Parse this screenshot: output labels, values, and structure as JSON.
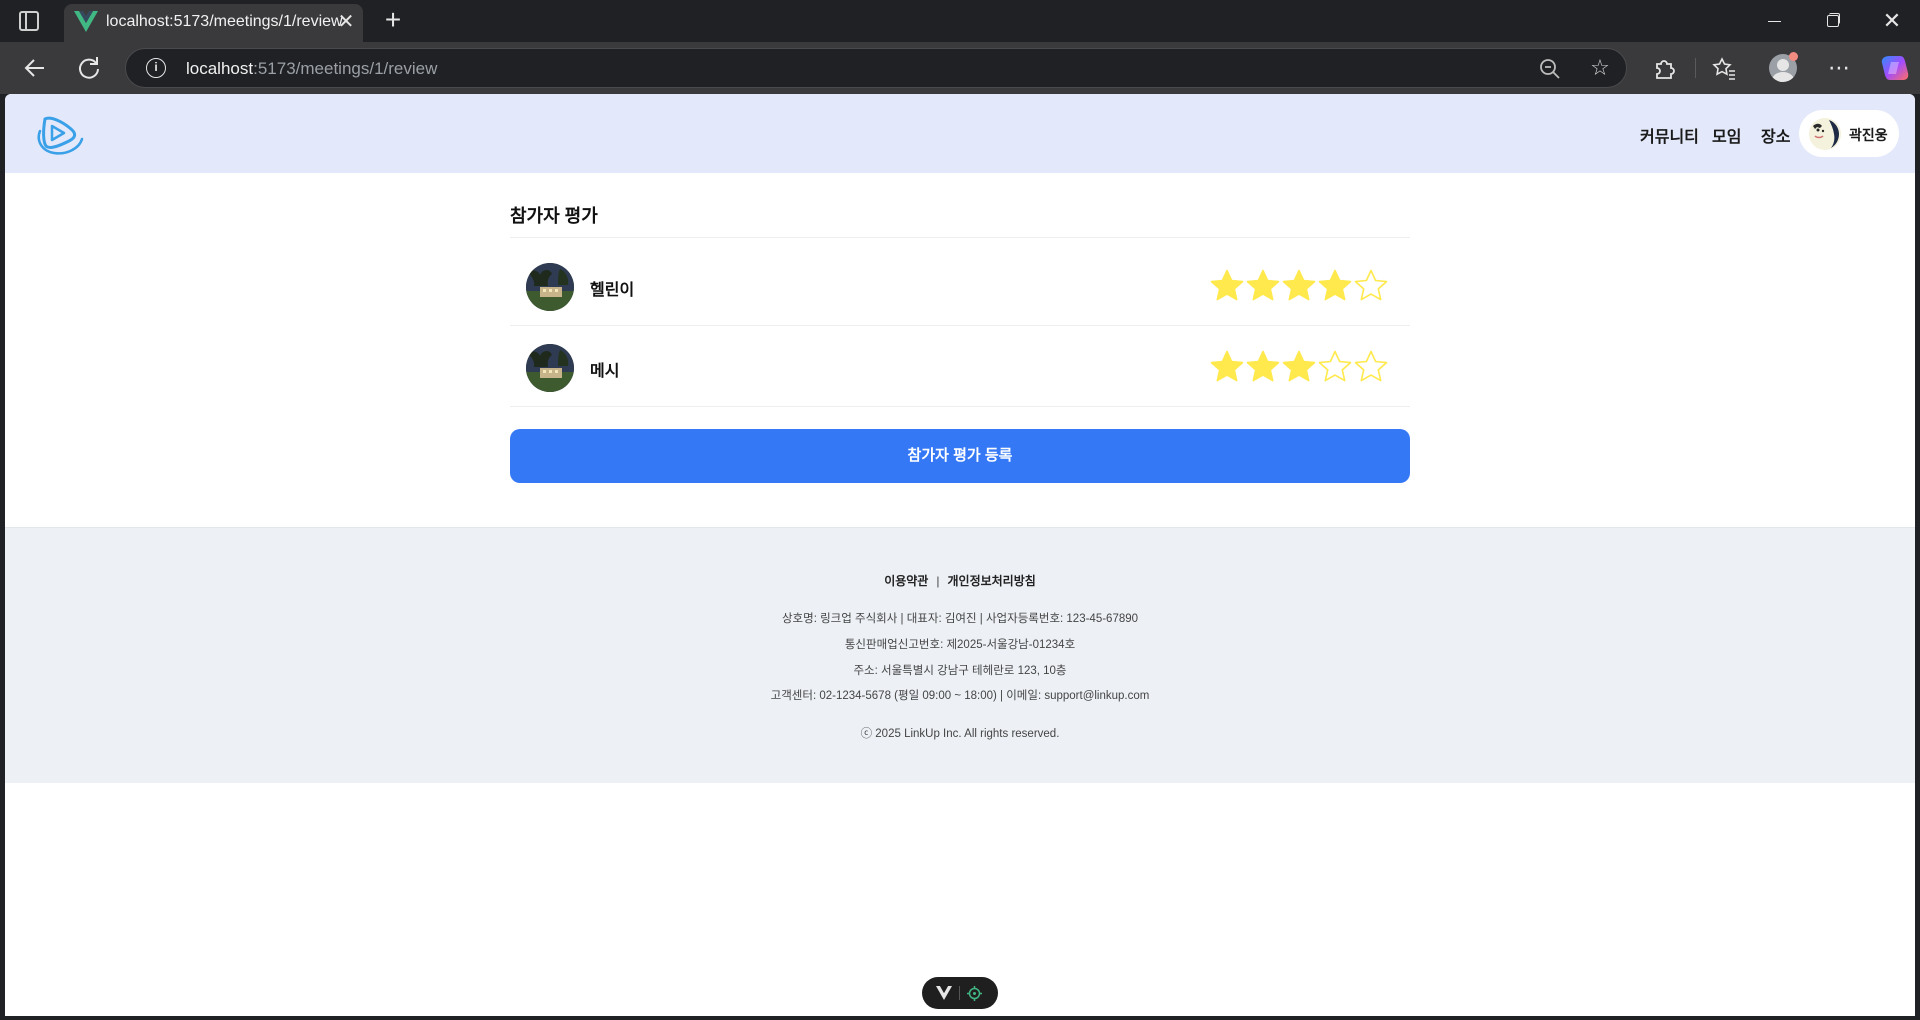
{
  "browser": {
    "tab_title": "localhost:5173/meetings/1/review",
    "url_host": "localhost",
    "url_path": ":5173/meetings/1/review"
  },
  "header": {
    "nav": {
      "community": "커뮤니티",
      "meeting": "모임",
      "place": "장소"
    },
    "user_name": "곽진웅"
  },
  "review": {
    "title": "참가자 평가",
    "participants": [
      {
        "name": "헬린이",
        "rating": 4,
        "max": 5
      },
      {
        "name": "메시",
        "rating": 3,
        "max": 5
      }
    ],
    "submit_label": "참가자 평가 등록"
  },
  "footer": {
    "terms": "이용약관",
    "separator": "|",
    "privacy": "개인정보처리방침",
    "company_line": "상호명: 링크업 주식회사 | 대표자: 김여진 | 사업자등록번호: 123-45-67890",
    "ecommerce_line": "통신판매업신고번호: 제2025-서울강남-01234호",
    "address_line": "주소: 서울특별시 강남구 테헤란로 123, 10층",
    "contact_line": "고객센터: 02-1234-5678 (평일 09:00 ~ 18:00) | 이메일: support@linkup.com",
    "copyright": "ⓒ 2025 LinkUp Inc. All rights reserved."
  },
  "colors": {
    "header_bg": "#e3e8fa",
    "primary": "#3478f6",
    "star_filled": "#ffe94d",
    "star_empty_stroke": "#ffe94d",
    "footer_bg": "#edf1f6"
  },
  "icons": {
    "tab_favicon": "vue-logo-icon",
    "back": "back-arrow-icon",
    "reload": "reload-icon",
    "site_info": "info-icon",
    "zoom": "zoom-out-icon",
    "favorite": "star-outline-icon",
    "extensions": "puzzle-icon",
    "favorites_list": "favorites-icon",
    "profile": "profile-icon",
    "more": "more-icon",
    "copilot": "copilot-icon",
    "logo": "linkup-logo-icon"
  }
}
